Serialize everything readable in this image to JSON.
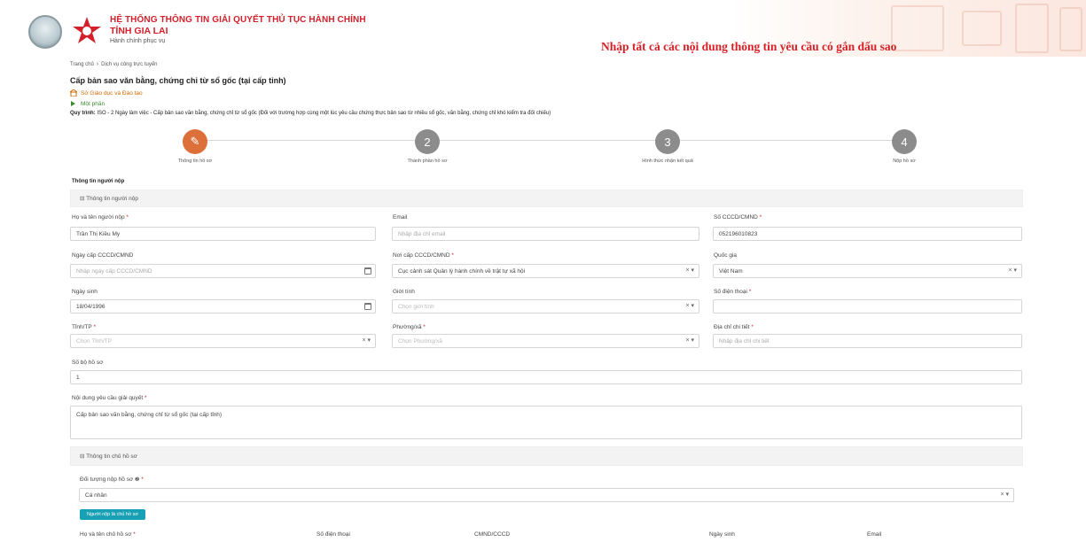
{
  "header": {
    "line1": "HỆ THỐNG THÔNG TIN GIẢI QUYẾT THỦ TỤC HÀNH CHÍNH",
    "line2": "TỈNH GIA LAI",
    "line3": "Hành chính phục vụ",
    "notice": "Nhập tất cả các nội dung thông tin yêu cầu có gắn dấu sao",
    "brand_color": "#d3202a"
  },
  "breadcrumb": {
    "home": "Trang chủ",
    "sep": "›",
    "current": "Dịch vụ công trực tuyến"
  },
  "procedure": {
    "title": "Cấp bản sao văn bằng, chứng chỉ từ sổ gốc (tại cấp tỉnh)",
    "agency": "Sở Giáo dục và Đào tạo",
    "level": "Một phần",
    "process_label": "Quy trình:",
    "process_value": " ISO - 2 Ngày làm việc - Cấp bản sao văn bằng, chứng chỉ từ sổ gốc (Đối với trường hợp cùng một lúc yêu cầu chứng thực bản sao từ nhiều sổ gốc, văn bằng, chứng chỉ khó kiểm tra đối chiếu)"
  },
  "steps": [
    {
      "num": "✎",
      "label": "Thông tin hồ sơ",
      "active": true
    },
    {
      "num": "2",
      "label": "Thành phần hồ sơ",
      "active": false
    },
    {
      "num": "3",
      "label": "Hình thức nhận kết quả",
      "active": false
    },
    {
      "num": "4",
      "label": "Nộp hồ sơ",
      "active": false
    }
  ],
  "section_title": "Thông tin người nộp",
  "applicant_bar": "⊟ Thông tin người nộp",
  "applicant": {
    "name_label": "Họ và tên người nộp",
    "name_value": "Trần Thị Kiều My",
    "email_label": "Email",
    "email_placeholder": "Nhập địa chỉ email",
    "id_label": "Số CCCD/CMND",
    "id_value": "052196010823",
    "issue_date_label": "Ngày cấp CCCD/CMND",
    "issue_date_placeholder": "Nhập ngày cấp CCCD/CMND",
    "issue_place_label": "Nơi cấp CCCD/CMND",
    "issue_place_value": "Cục cảnh sát Quản lý hành chính về trật tự xã hội",
    "country_label": "Quốc gia",
    "country_value": "Việt Nam",
    "dob_label": "Ngày sinh",
    "dob_value": "18/04/1996",
    "gender_label": "Giới tính",
    "gender_placeholder": "Chọn giới tính",
    "phone_label": "Số điện thoại",
    "province_label": "Tỉnh/TP",
    "province_placeholder": "Chọn Tỉnh/TP",
    "ward_label": "Phường/xã",
    "ward_placeholder": "Chọn Phường/xã",
    "address_label": "Địa chỉ chi tiết",
    "address_placeholder": "Nhập địa chỉ chi tiết",
    "sets_label": "Số bộ hồ sơ",
    "sets_value": "1",
    "request_label": "Nội dung yêu cầu giải quyết",
    "request_value": "Cấp bản sao văn bằng, chứng chỉ từ sổ gốc (tại cấp tỉnh)"
  },
  "owner_bar": "⊟ Thông tin chủ hồ sơ",
  "owner": {
    "type_label": "Đối tượng nộp hồ sơ",
    "help_icon": "❷",
    "type_value": "Cá nhân",
    "same_button": "Người nộp là chủ hồ sơ",
    "name_label": "Họ và tên chủ hồ sơ",
    "phone_label": "Số điện thoại",
    "id_label": "CMND/CCCD",
    "dob_label": "Ngày sinh",
    "email_label": "Email"
  },
  "select_tail": "× ▾",
  "req_mark": " *"
}
